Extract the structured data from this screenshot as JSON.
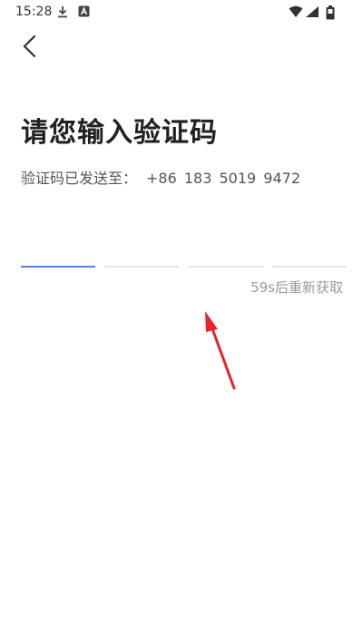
{
  "status_bar": {
    "time": "15:28",
    "icons": [
      "download-icon",
      "app-notification-icon",
      "wifi-icon",
      "signal-icon",
      "battery-icon"
    ]
  },
  "header": {
    "back_icon": "chevron-left-icon"
  },
  "main": {
    "title": "请您输入验证码",
    "subtitle_label": "验证码已发送至：",
    "phone_number": "+86  183 5019 9472",
    "code_boxes": [
      "",
      "",
      "",
      ""
    ],
    "resend_text": "59s后重新获取"
  },
  "annotation": {
    "arrow_color": "#e8232b"
  },
  "colors": {
    "accent": "#5b7ee5",
    "inactive_line": "#e6e6e6",
    "muted_text": "#9a9a9a"
  }
}
